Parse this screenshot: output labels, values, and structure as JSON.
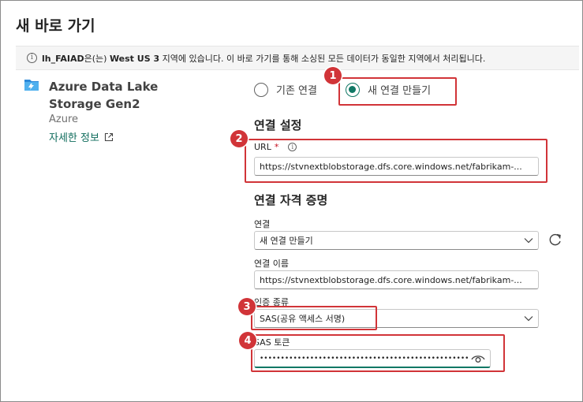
{
  "dialog": {
    "title": "새 바로 가기"
  },
  "info_bar": {
    "workspace": "lh_FAIAD",
    "text_1": "은(는) ",
    "region": "West US 3",
    "text_2": " 지역에 있습니다. 이 바로 가기를 통해 소싱된 모든 데이터가 동일한 지역에서 처리됩니다."
  },
  "source": {
    "name": "Azure Data Lake Storage Gen2",
    "provider": "Azure",
    "details_link": "자세한 정보",
    "icon": "storage-icon"
  },
  "connection_mode": {
    "option_existing": "기존 연결",
    "option_new": "새 연결 만들기",
    "selected": "새 연결 만들기"
  },
  "connection_settings": {
    "heading": "연결 설정",
    "url_label": "URL",
    "url_required_mark": "*",
    "url_value": "https://stvnextblobstorage.dfs.core.windows.net/fabrikam-..."
  },
  "credentials": {
    "heading": "연결 자격 증명",
    "connection_label": "연결",
    "connection_value": "새 연결 만들기",
    "connection_name_label": "연결 이름",
    "connection_name_value": "https://stvnextblobstorage.dfs.core.windows.net/fabrikam-...",
    "auth_type_label": "인증 종류",
    "auth_type_value": "SAS(공유 액세스 서명)",
    "sas_token_label": "SAS 토큰",
    "sas_token_value": "••••••••••••••••••••••••••••••••••••••••••••••••••••••••••••••"
  },
  "annotations": {
    "badge_1": "1",
    "badge_2": "2",
    "badge_3": "3",
    "badge_4": "4",
    "highlight_color": "#d13438"
  },
  "colors": {
    "accent": "#117865",
    "link": "#0f6c5c"
  }
}
